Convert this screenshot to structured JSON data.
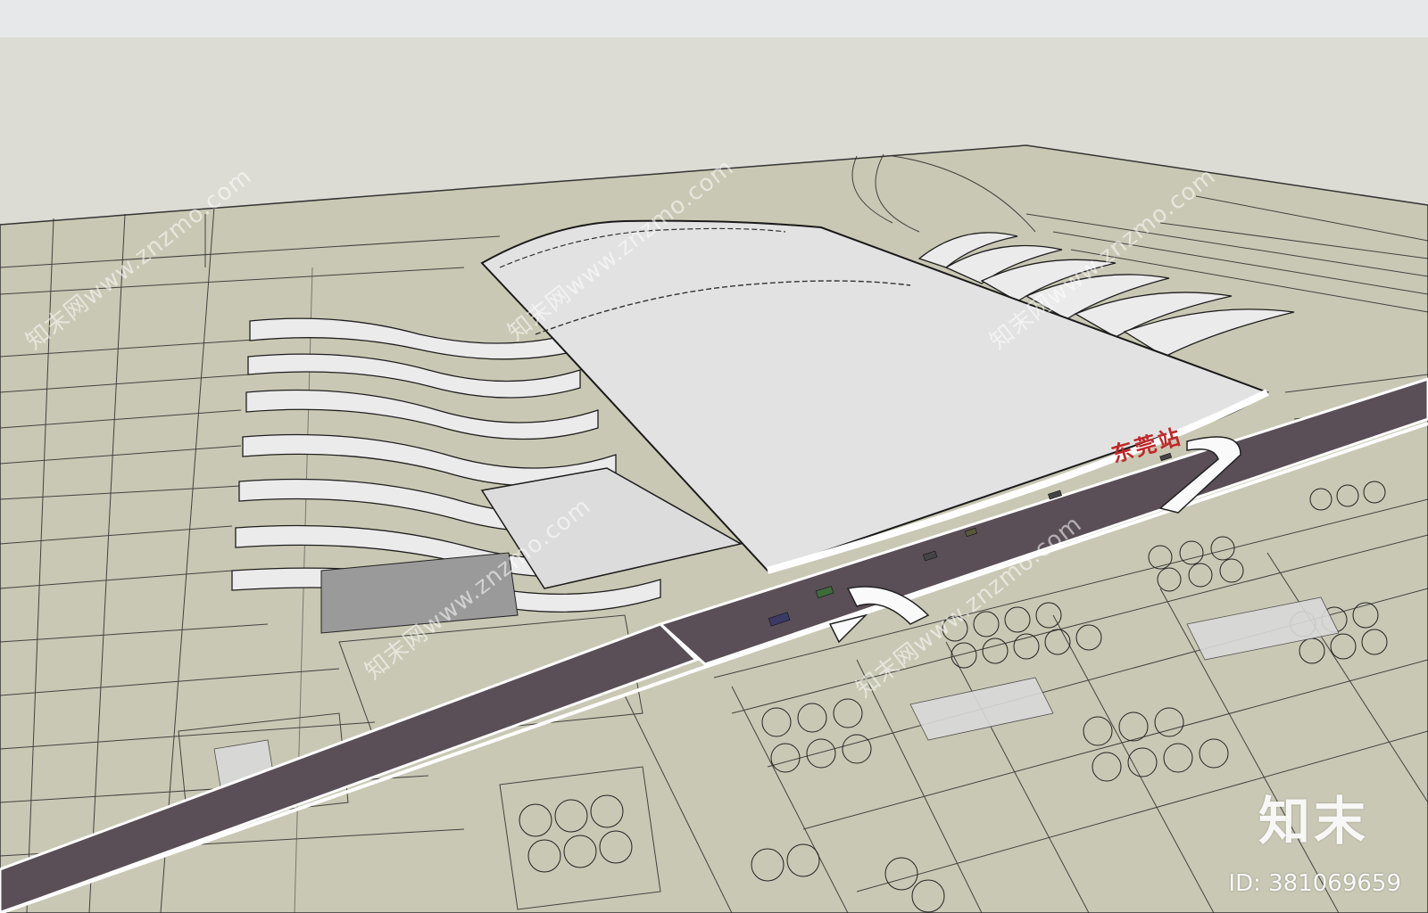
{
  "station_sign": "东莞站",
  "watermark": {
    "diagonal_text": "知末网www.znzmo.com",
    "brand": "知末",
    "image_id": "ID: 381069659"
  },
  "colors": {
    "ground": "#c9c8b4",
    "road": "#5a4f56",
    "roof": "#e2e2e2",
    "sky": "#dcdcd4",
    "sign": "#c0282a"
  }
}
